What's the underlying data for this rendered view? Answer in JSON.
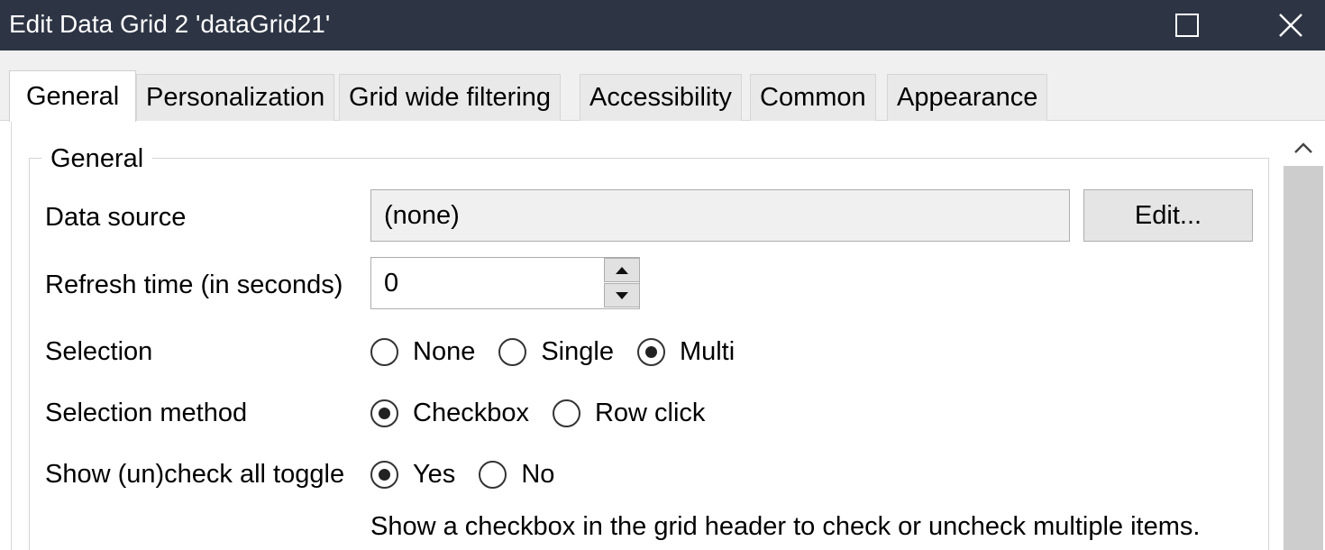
{
  "window": {
    "title": "Edit Data Grid 2 'dataGrid21'",
    "maximize_icon": "maximize-icon",
    "close_icon": "close-icon"
  },
  "tabs": [
    {
      "label": "General",
      "active": true
    },
    {
      "label": "Personalization",
      "active": false
    },
    {
      "label": "Grid wide filtering",
      "active": false
    },
    {
      "label": "Accessibility",
      "active": false
    },
    {
      "label": "Common",
      "active": false
    },
    {
      "label": "Appearance",
      "active": false
    }
  ],
  "general": {
    "legend": "General",
    "data_source": {
      "label": "Data source",
      "value": "(none)",
      "edit_label": "Edit..."
    },
    "refresh_time": {
      "label": "Refresh time (in seconds)",
      "value": "0"
    },
    "selection": {
      "label": "Selection",
      "options": [
        "None",
        "Single",
        "Multi"
      ],
      "selected": "Multi"
    },
    "selection_method": {
      "label": "Selection method",
      "options": [
        "Checkbox",
        "Row click"
      ],
      "selected": "Checkbox"
    },
    "show_check_all": {
      "label": "Show (un)check all toggle",
      "options": [
        "Yes",
        "No"
      ],
      "selected": "Yes",
      "help": "Show a checkbox in the grid header to check or uncheck multiple items."
    }
  },
  "colors": {
    "titlebar": "#2d3444",
    "tabstrip": "#f0f0f0",
    "scroll_thumb": "#cdcdcd"
  }
}
